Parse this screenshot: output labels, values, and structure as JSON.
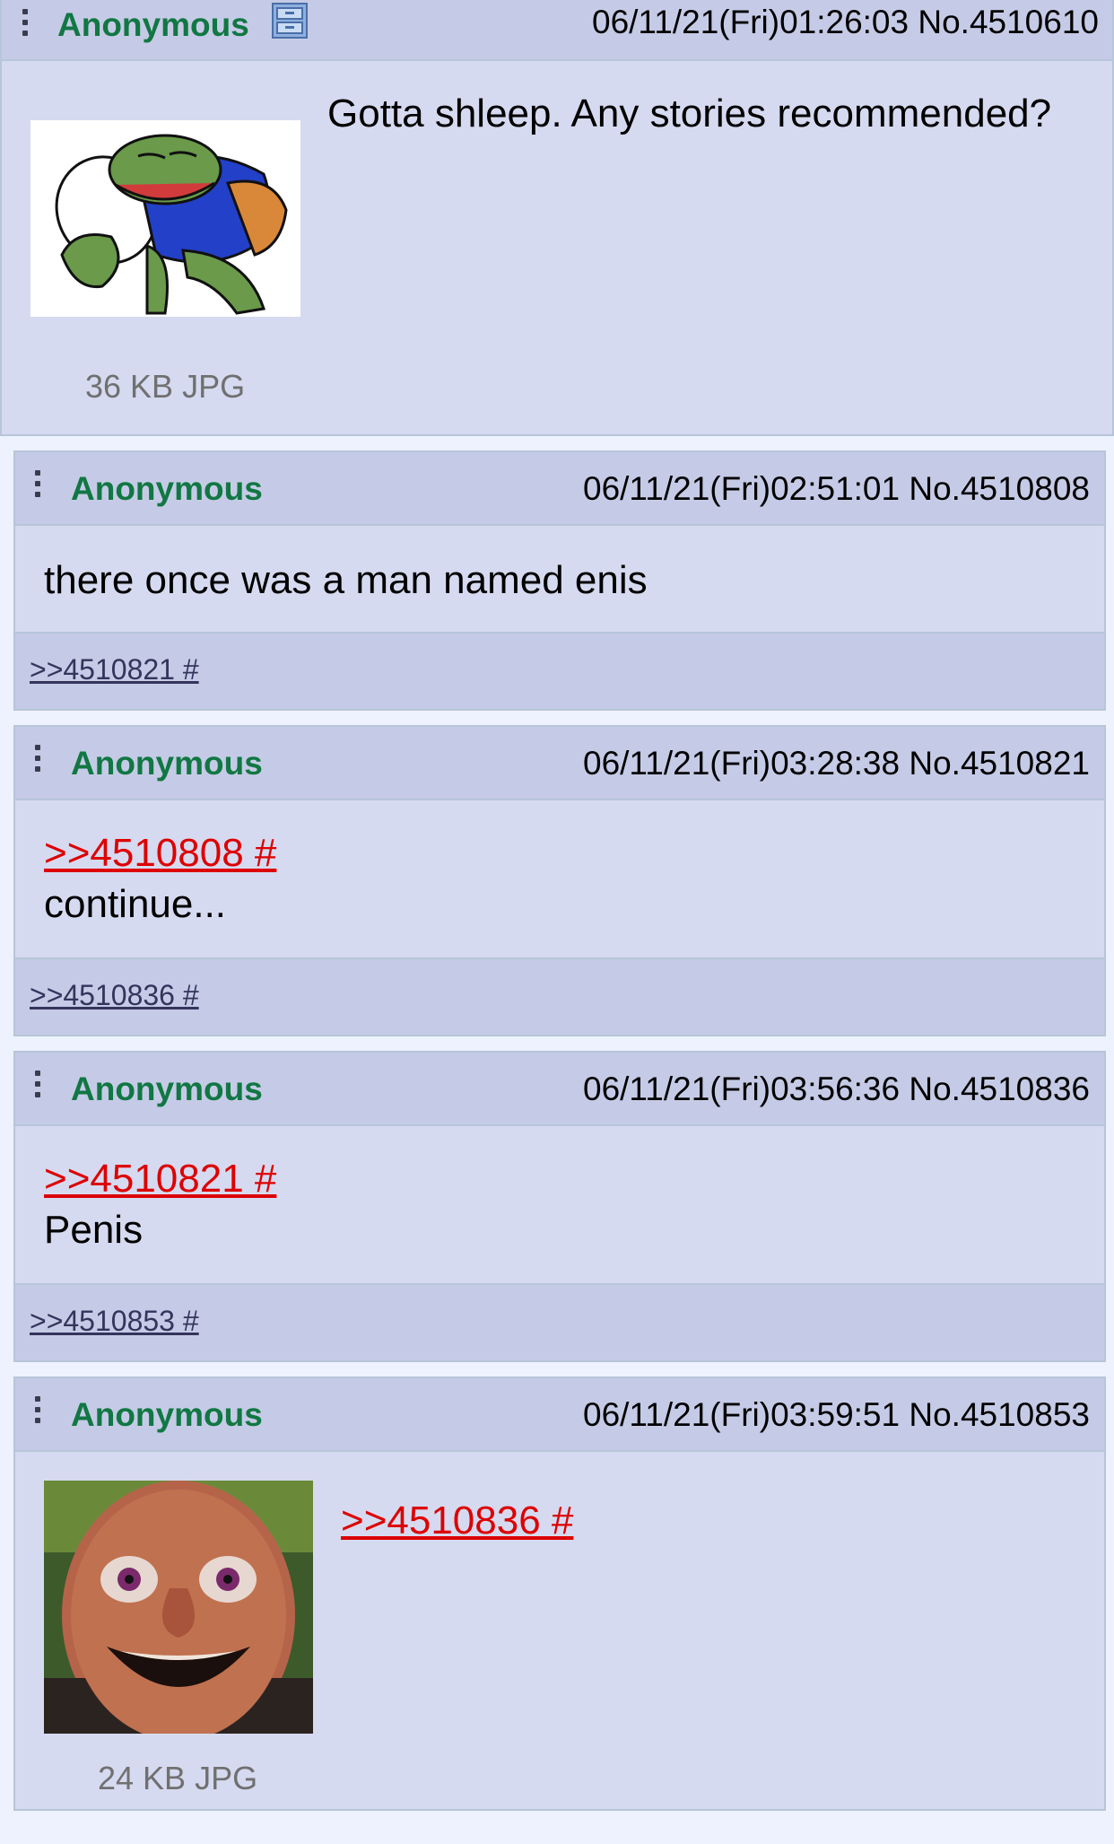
{
  "op": {
    "name": "Anonymous",
    "meta": "06/11/21(Fri)01:26:03 No.4510610",
    "text": "Gotta shleep. Any stories recommended?",
    "file_info": "36 KB JPG"
  },
  "replies": [
    {
      "name": "Anonymous",
      "meta": "06/11/21(Fri)02:51:01 No.4510808",
      "text": "there once was a man named enis",
      "backlink": ">>4510821 #"
    },
    {
      "name": "Anonymous",
      "meta": "06/11/21(Fri)03:28:38 No.4510821",
      "quote": ">>4510808 #",
      "text": "continue...",
      "backlink": ">>4510836 #"
    },
    {
      "name": "Anonymous",
      "meta": "06/11/21(Fri)03:56:36 No.4510836",
      "quote": ">>4510821 #",
      "text": "Penis",
      "backlink": ">>4510853 #"
    },
    {
      "name": "Anonymous",
      "meta": "06/11/21(Fri)03:59:51 No.4510853",
      "quote": ">>4510836 #",
      "file_info": "24 KB JPG"
    }
  ],
  "colors": {
    "background": "#eef2ff",
    "post": "#d6daf0",
    "header": "#c5cbe6",
    "name": "#117743",
    "quotelink": "#dd0000",
    "backlink": "#34345c"
  },
  "icons": [
    "post-menu-icon",
    "archive-cabinet-icon"
  ]
}
